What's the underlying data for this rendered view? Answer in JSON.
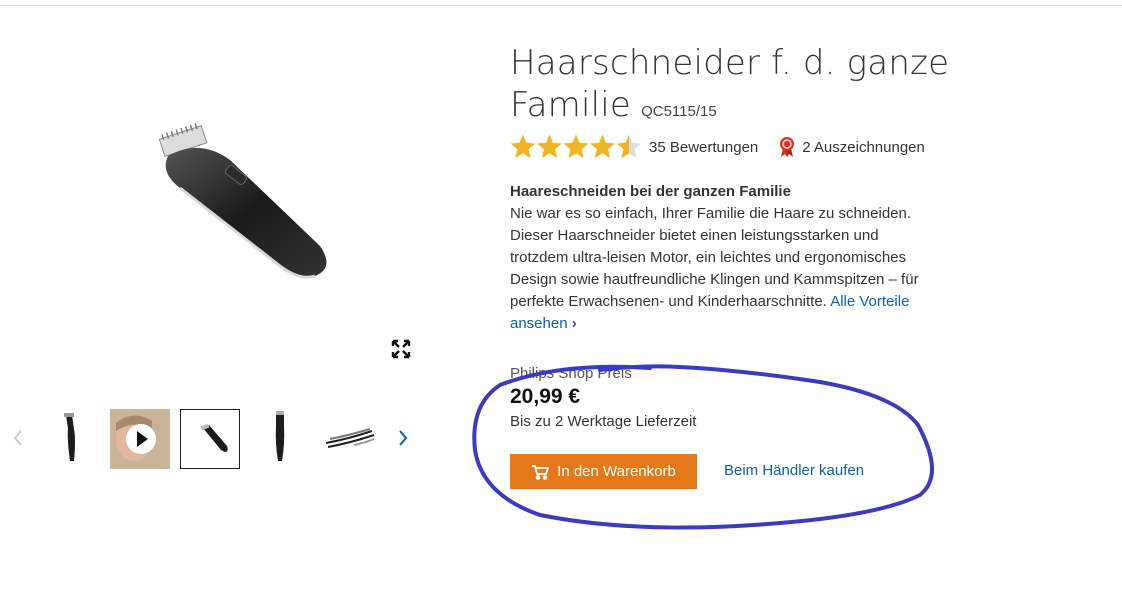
{
  "product": {
    "title": "Haarschneider f. d. ganze Familie",
    "model": "QC5115/15"
  },
  "rating": {
    "stars": 4.5,
    "reviews_text": "35 Bewertungen",
    "awards_text": "2 Auszeichnungen"
  },
  "description": {
    "heading": "Haareschneiden bei der ganzen Familie",
    "body": "Nie war es so einfach, Ihrer Familie die Haare zu schneiden. Dieser Haarschneider bietet einen leistungsstarken und trotzdem ultra-leisen Motor, ein leichtes und ergonomisches Design sowie hautfreundliche Klingen und Kammspitzen – für perfekte Erwachsenen- und Kinderhaarschnitte.",
    "link_text": "Alle Vorteile ansehen",
    "link_chevron": "›"
  },
  "pricing": {
    "label": "Philips Shop Preis",
    "price": "20,99 €",
    "delivery": "Bis zu 2 Werktage Lieferzeit"
  },
  "actions": {
    "cart_label": "In den Warenkorb",
    "dealer_label": "Beim Händler kaufen"
  },
  "gallery": {
    "selected_index": 2,
    "thumbnails": [
      "side-view",
      "video",
      "angled-view",
      "upright-view",
      "comb-attachments"
    ]
  },
  "colors": {
    "accent": "#e3791b",
    "link": "#0e5fa3",
    "star": "#f0b323",
    "annotation": "#3b3bbf"
  }
}
